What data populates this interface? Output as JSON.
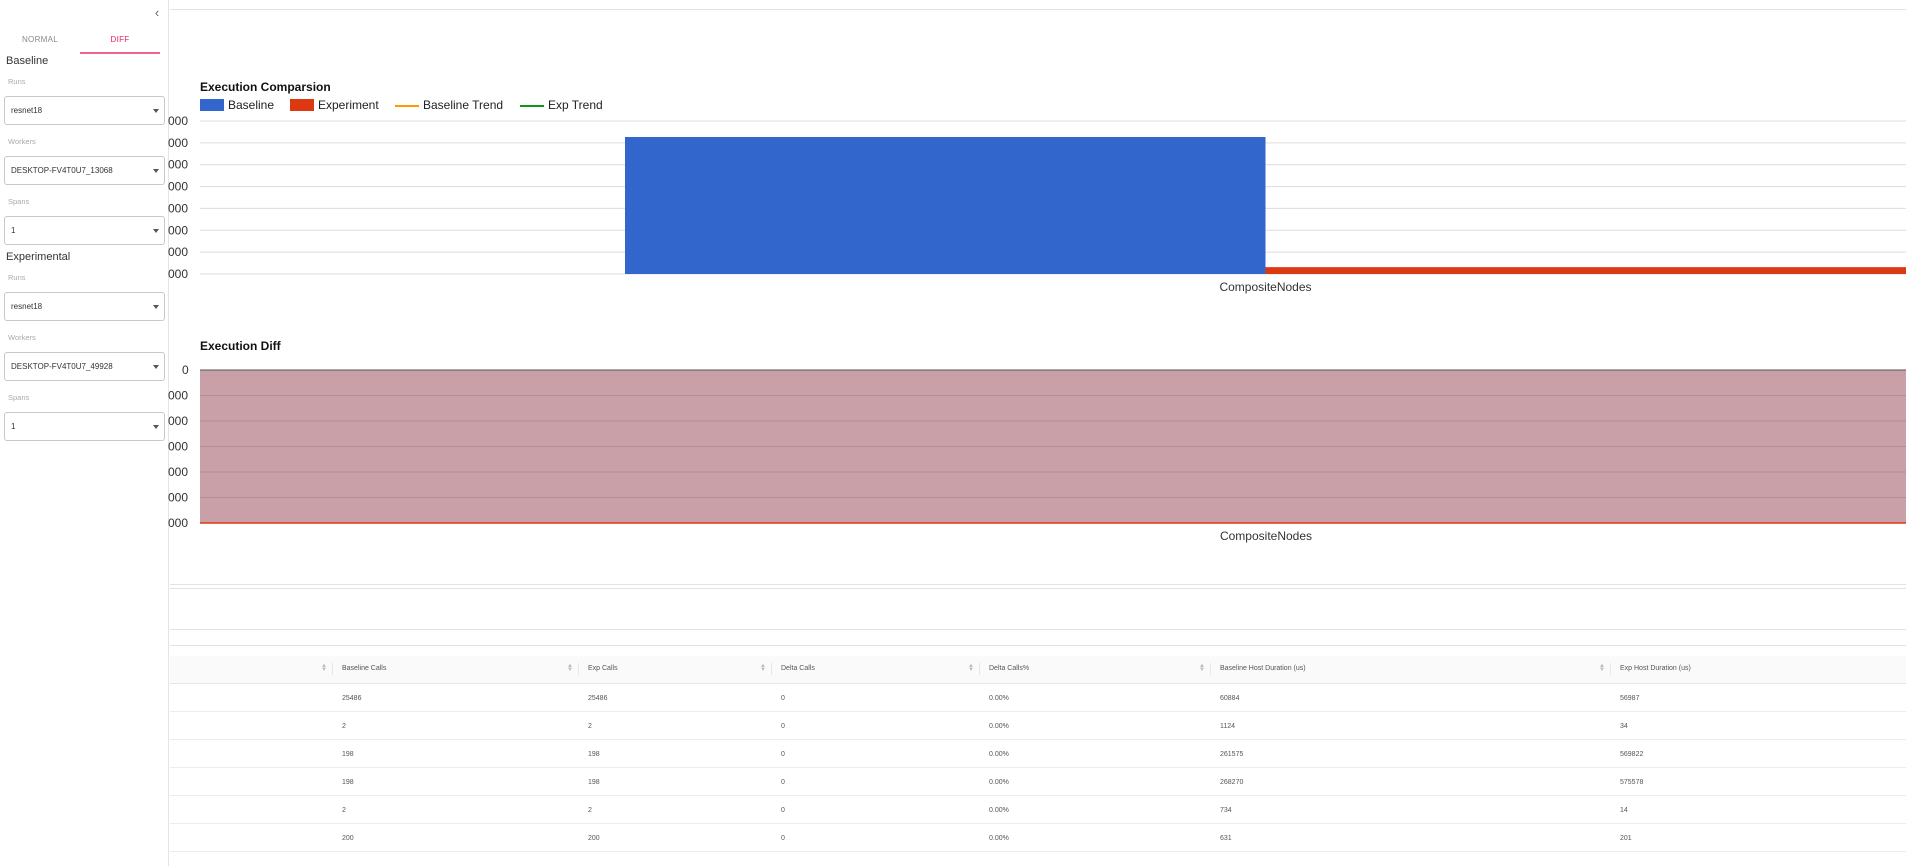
{
  "sidebar": {
    "collapse_icon": "chevron-left-icon",
    "tabs": [
      "NORMAL",
      "DIFF"
    ],
    "active_tab": "DIFF",
    "baseline": {
      "title": "Baseline",
      "runs_label": "Runs",
      "runs_value": "resnet18",
      "workers_label": "Workers",
      "workers_value": "DESKTOP-FV4T0U7_13068",
      "spans_label": "Spans",
      "spans_value": "1"
    },
    "experimental": {
      "title": "Experimental",
      "runs_label": "Runs",
      "runs_value": "resnet18",
      "workers_label": "Workers",
      "workers_value": "DESKTOP-FV4T0U7_49928",
      "spans_label": "Spans",
      "spans_value": "1"
    }
  },
  "comparison": {
    "title": "Execution Comparsion",
    "legend": [
      "Baseline",
      "Experiment",
      "Baseline Trend",
      "Exp Trend"
    ],
    "legend_colors": [
      "#3366cc",
      "#dc3912",
      "#ff9900",
      "#109618"
    ]
  },
  "diff": {
    "title": "Execution Diff",
    "fill_color": "#c9a0a8",
    "line_color": "#dc3912"
  },
  "chart_data": [
    {
      "type": "bar",
      "title": "Execution Comparsion",
      "categories": [
        "CompositeNodes"
      ],
      "series": [
        {
          "name": "Baseline",
          "values": [
            1
          ]
        },
        {
          "name": "Experiment",
          "values": [
            0.05
          ]
        }
      ],
      "ytick_labels": [
        "000",
        "000",
        "000",
        "000",
        "000",
        "000",
        "000",
        "000"
      ],
      "grid": true,
      "legend_placement": "top-left"
    },
    {
      "type": "area",
      "title": "Execution Diff",
      "categories": [
        "CompositeNodes"
      ],
      "ytick_labels": [
        "0",
        "000",
        "000",
        "000",
        "000",
        "000",
        "000"
      ],
      "grid": true
    }
  ],
  "table": {
    "columns": [
      "Baseline Calls",
      "Exp Calls",
      "Delta Calls",
      "Delta Calls%",
      "Baseline Host Duration (us)",
      "Exp Host Duration (us)"
    ],
    "rows": [
      [
        "25486",
        "25486",
        "0",
        "0.00%",
        "60884",
        "56987"
      ],
      [
        "2",
        "2",
        "0",
        "0.00%",
        "1124",
        "34"
      ],
      [
        "198",
        "198",
        "0",
        "0.00%",
        "261575",
        "569822"
      ],
      [
        "198",
        "198",
        "0",
        "0.00%",
        "268270",
        "575578"
      ],
      [
        "2",
        "2",
        "0",
        "0.00%",
        "734",
        "14"
      ],
      [
        "200",
        "200",
        "0",
        "0.00%",
        "631",
        "201"
      ]
    ]
  }
}
